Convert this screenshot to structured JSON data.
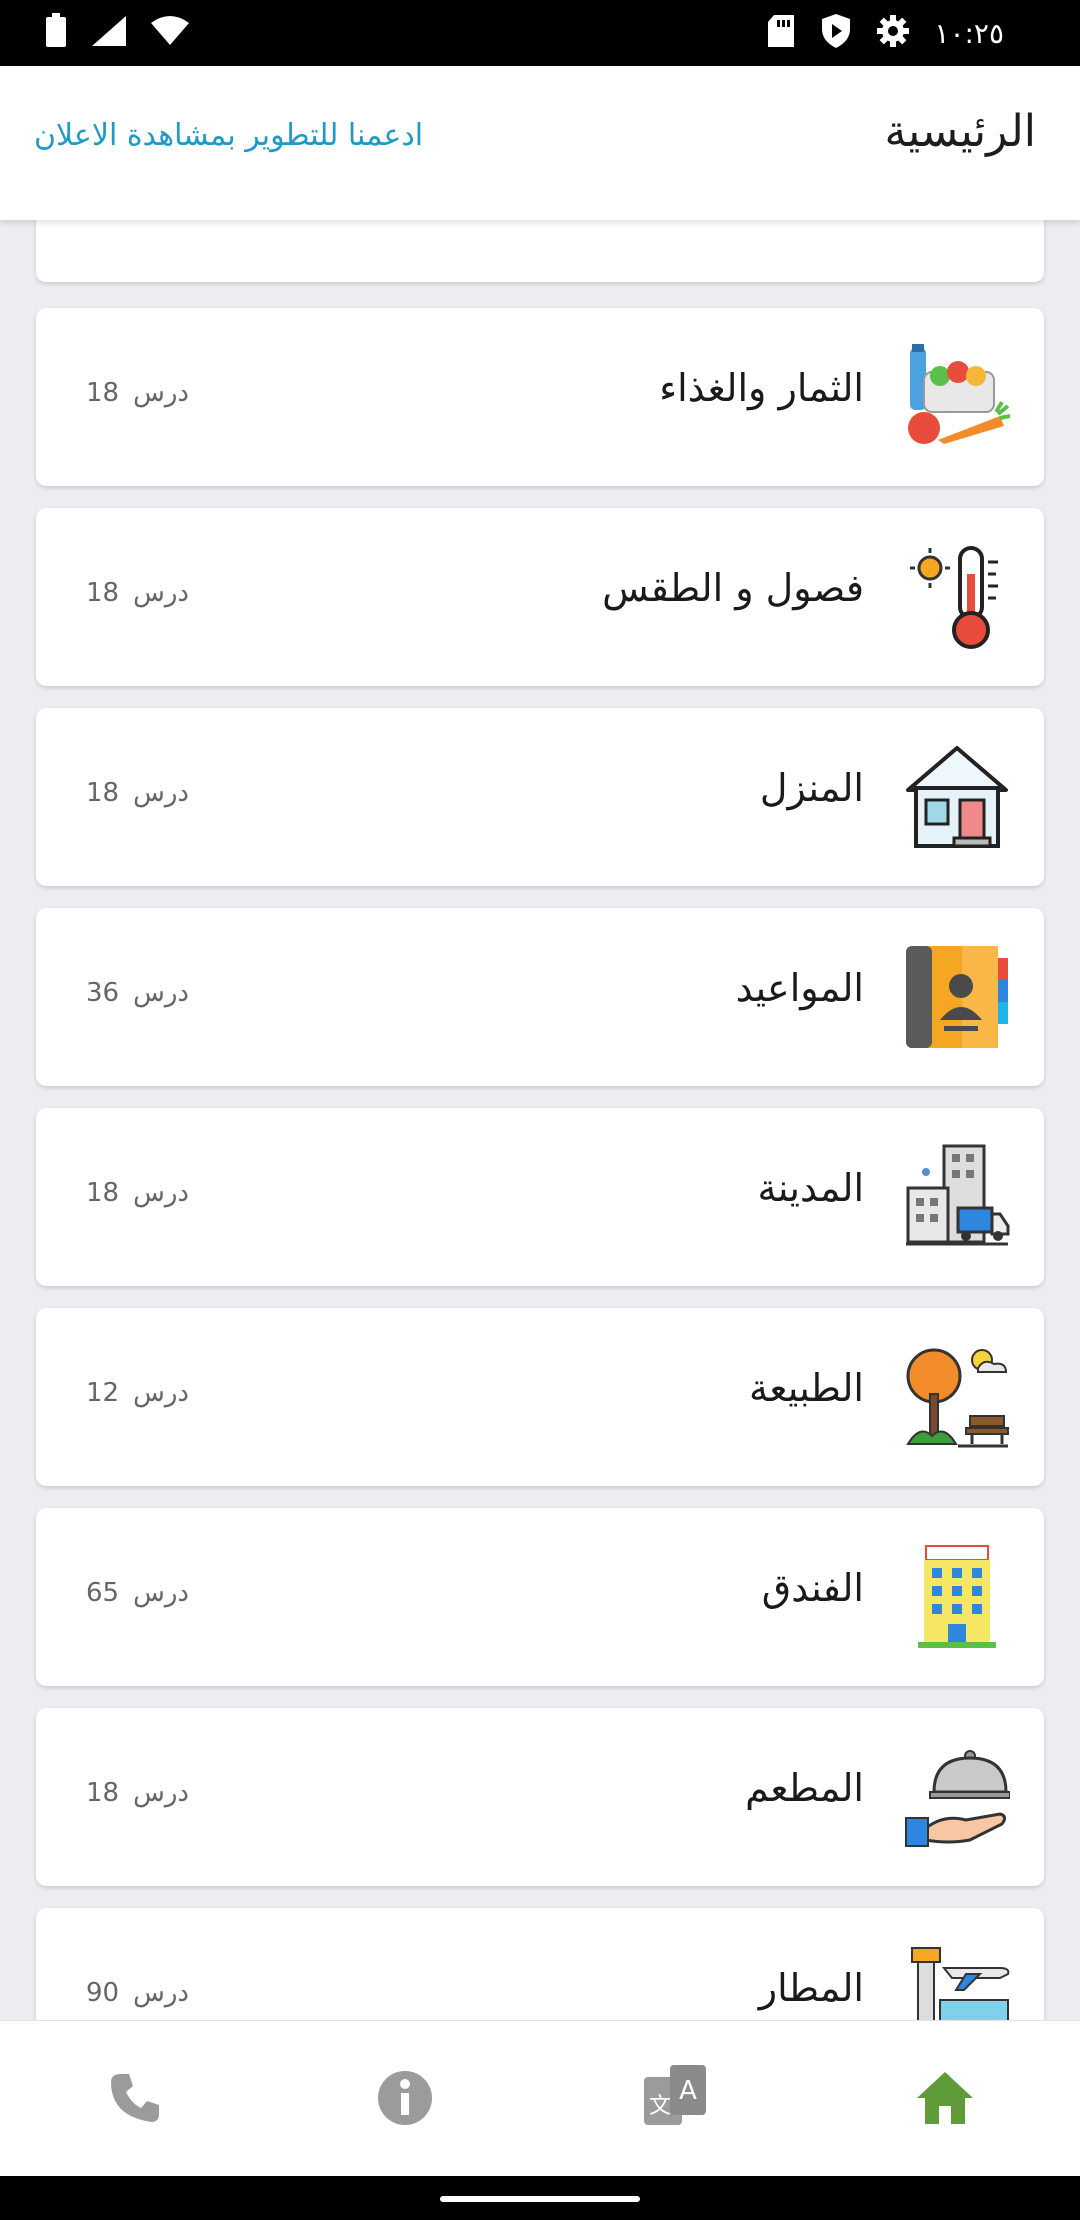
{
  "status_bar": {
    "time": "١٠:٢٥",
    "icons": [
      "battery-icon",
      "signal-icon",
      "wifi-icon",
      "sd-card-icon",
      "shield-icon",
      "gear-icon"
    ]
  },
  "app_bar": {
    "title": "الرئيسية",
    "ad_link": "ادعمنا للتطوير بمشاهدة الاعلان"
  },
  "lessons_unit": "درس",
  "categories": [
    {
      "title": "",
      "count": "",
      "icon": "partial-circles-icon"
    },
    {
      "title": "الثمار والغذاء",
      "count": "18",
      "icon": "fruits-food-icon"
    },
    {
      "title": "فصول و الطقس",
      "count": "18",
      "icon": "thermometer-weather-icon"
    },
    {
      "title": "المنزل",
      "count": "18",
      "icon": "house-icon"
    },
    {
      "title": "المواعيد",
      "count": "36",
      "icon": "address-book-icon"
    },
    {
      "title": "المدينة",
      "count": "18",
      "icon": "city-buildings-icon"
    },
    {
      "title": "الطبيعة",
      "count": "12",
      "icon": "nature-tree-icon"
    },
    {
      "title": "الفندق",
      "count": "65",
      "icon": "hotel-icon"
    },
    {
      "title": "المطعم",
      "count": "18",
      "icon": "restaurant-cloche-icon"
    },
    {
      "title": "المطار",
      "count": "90",
      "icon": "airport-plane-icon"
    }
  ],
  "bottom_nav": {
    "items": [
      "phone-icon",
      "info-icon",
      "translate-icon",
      "home-icon"
    ],
    "active": "home-icon",
    "colors": {
      "active": "#5f9b38",
      "inactive": "#9b9b9b"
    }
  }
}
